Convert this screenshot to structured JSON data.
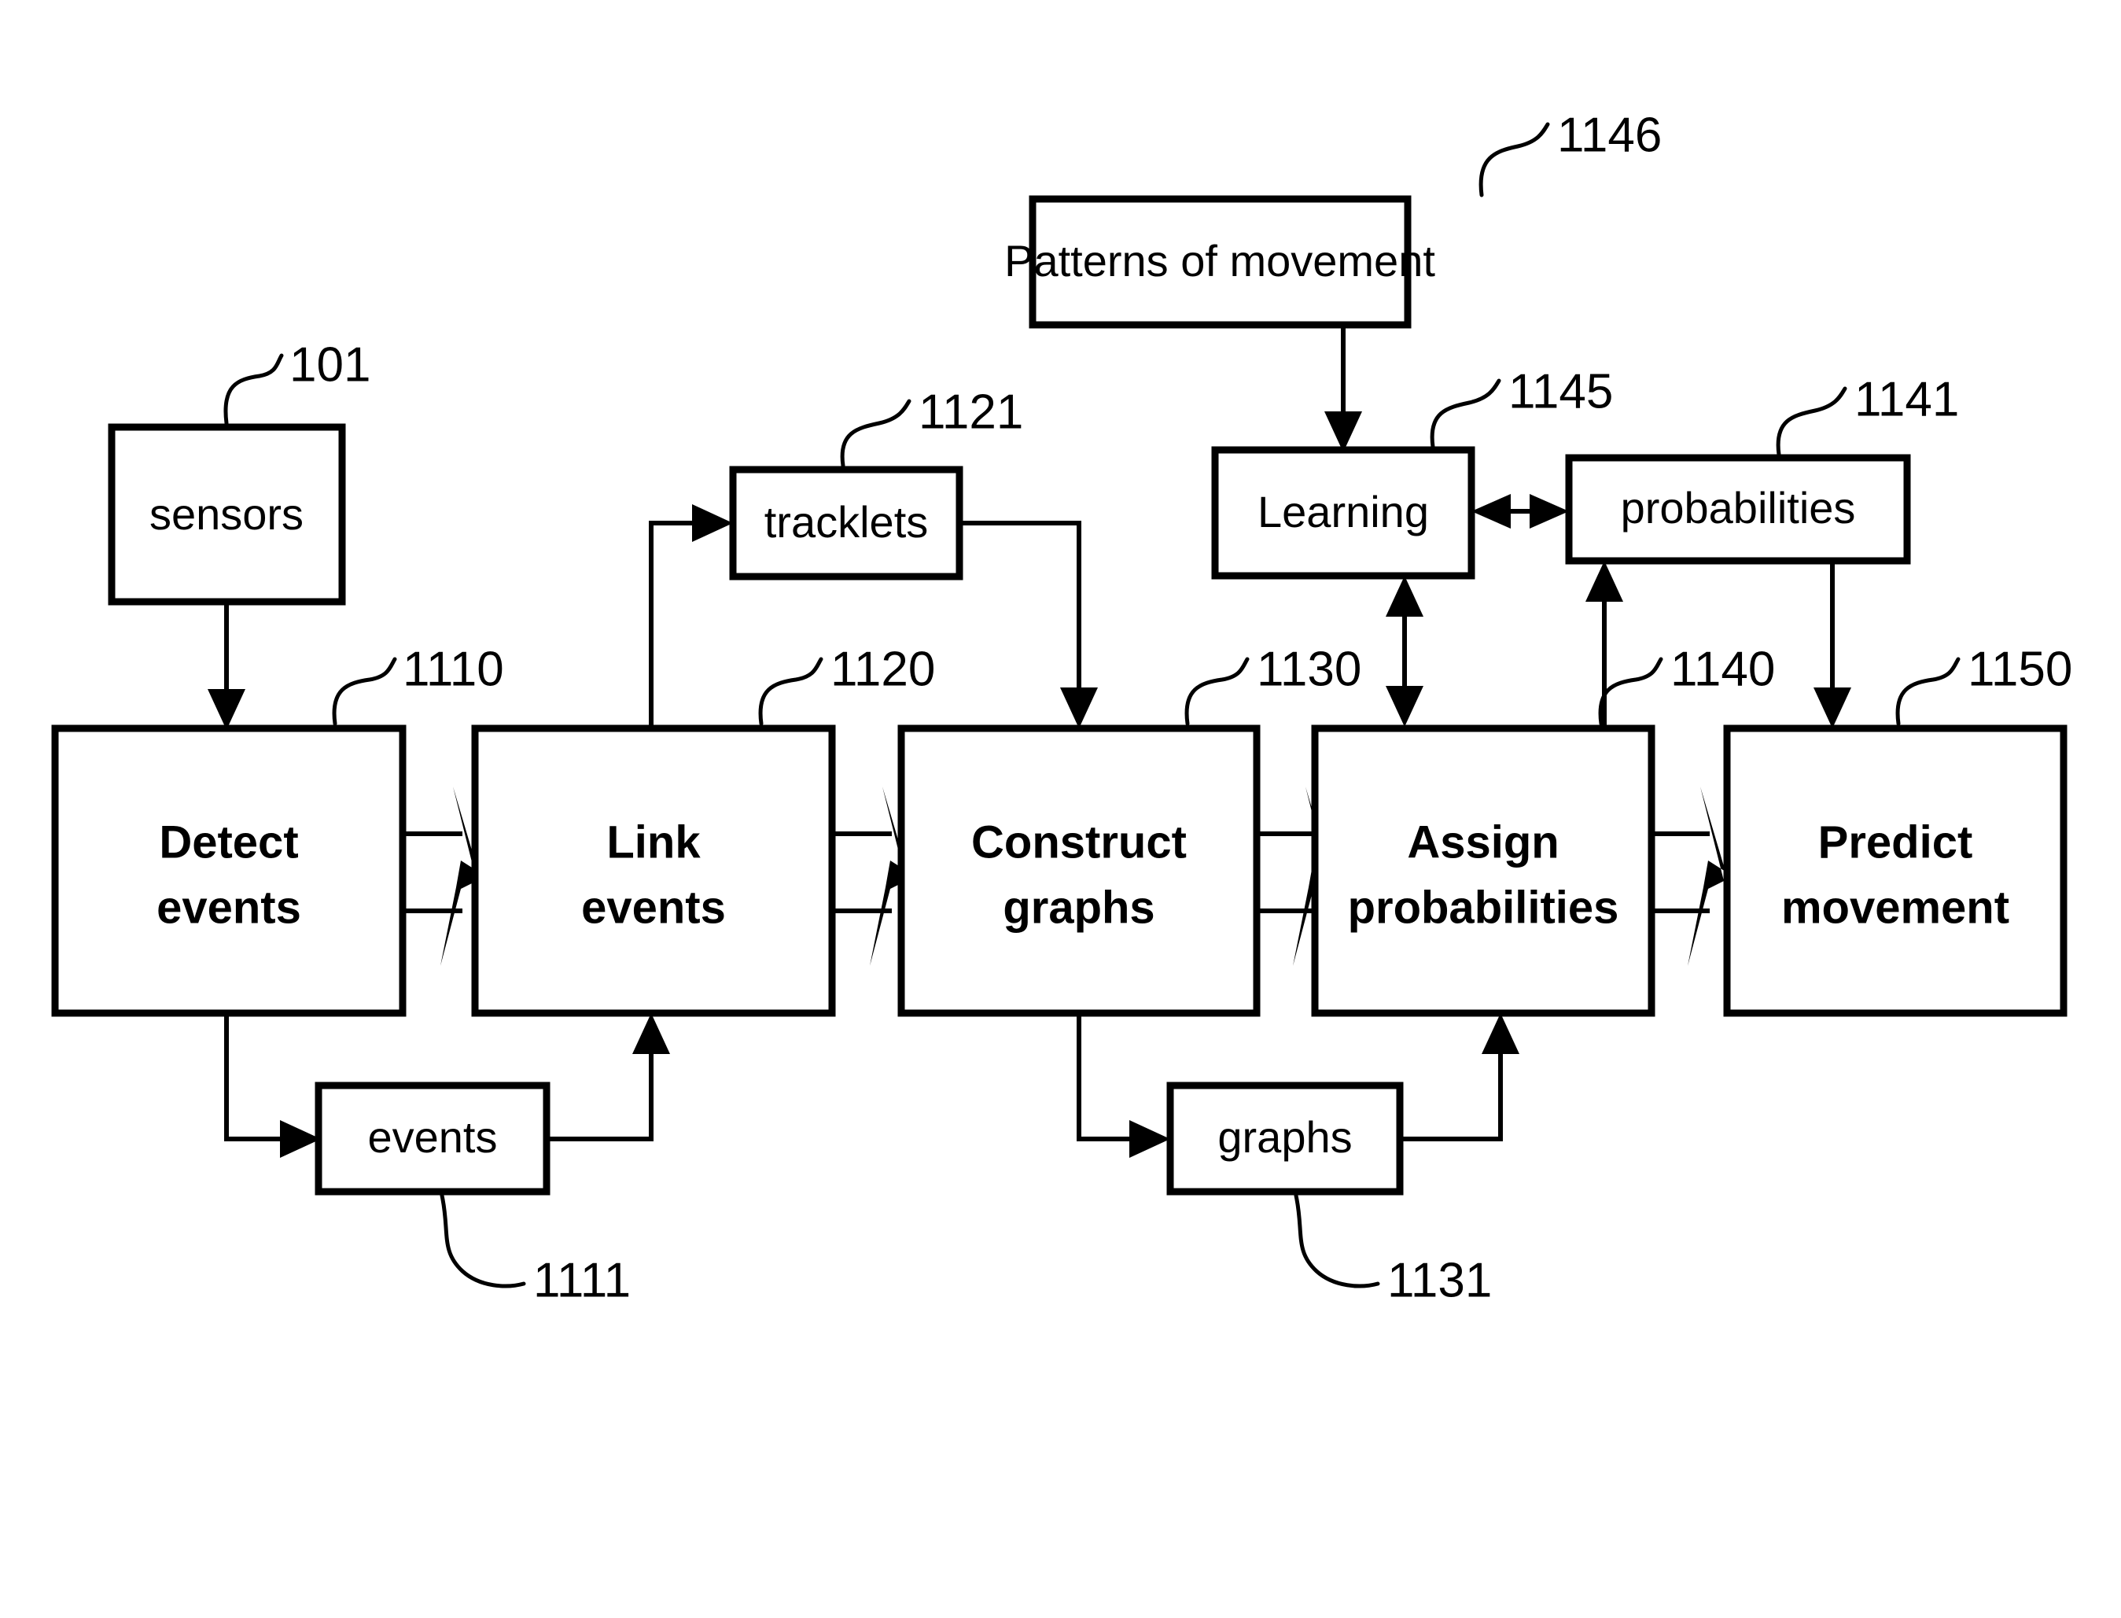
{
  "figure": {
    "type": "patent-flow-diagram",
    "background_color": "#ffffff",
    "line_color": "#000000"
  },
  "process_boxes": [
    {
      "id": "detect-events",
      "label_line1": "Detect",
      "label_line2": "events",
      "ref": "1110"
    },
    {
      "id": "link-events",
      "label_line1": "Link",
      "label_line2": "events",
      "ref": "1120"
    },
    {
      "id": "construct-graphs",
      "label_line1": "Construct",
      "label_line2": "graphs",
      "ref": "1130"
    },
    {
      "id": "assign-probabilities",
      "label_line1": "Assign",
      "label_line2": "probabilities",
      "ref": "1140"
    },
    {
      "id": "predict-movement",
      "label_line1": "Predict",
      "label_line2": "movement",
      "ref": "1150"
    }
  ],
  "data_boxes": [
    {
      "id": "sensors",
      "label": "sensors",
      "ref": "101"
    },
    {
      "id": "tracklets",
      "label": "tracklets",
      "ref": "1121"
    },
    {
      "id": "events",
      "label": "events",
      "ref": "1111"
    },
    {
      "id": "graphs",
      "label": "graphs",
      "ref": "1131"
    },
    {
      "id": "patterns-of-movement",
      "label": "Patterns of movement",
      "ref": "1146"
    },
    {
      "id": "learning",
      "label": "Learning",
      "ref": "1145"
    },
    {
      "id": "probabilities",
      "label": "probabilities",
      "ref": "1141"
    }
  ],
  "reference_numerals": [
    {
      "id": "ref-101",
      "value": "101"
    },
    {
      "id": "ref-1110",
      "value": "1110"
    },
    {
      "id": "ref-1111",
      "value": "1111"
    },
    {
      "id": "ref-1120",
      "value": "1120"
    },
    {
      "id": "ref-1121",
      "value": "1121"
    },
    {
      "id": "ref-1130",
      "value": "1130"
    },
    {
      "id": "ref-1131",
      "value": "1131"
    },
    {
      "id": "ref-1140",
      "value": "1140"
    },
    {
      "id": "ref-1141",
      "value": "1141"
    },
    {
      "id": "ref-1145",
      "value": "1145"
    },
    {
      "id": "ref-1146",
      "value": "1146"
    },
    {
      "id": "ref-1150",
      "value": "1150"
    }
  ],
  "labels": {
    "sensors": "sensors",
    "detect_line1": "Detect",
    "detect_line2": "events",
    "link_line1": "Link",
    "link_line2": "events",
    "construct_line1": "Construct",
    "construct_line2": "graphs",
    "assign_line1": "Assign",
    "assign_line2": "probabilities",
    "predict_line1": "Predict",
    "predict_line2": "movement",
    "tracklets": "tracklets",
    "events": "events",
    "graphs": "graphs",
    "patterns_of_movement": "Patterns of movement",
    "learning": "Learning",
    "probabilities": "probabilities",
    "ref_101": "101",
    "ref_1110": "1110",
    "ref_1111": "1111",
    "ref_1120": "1120",
    "ref_1121": "1121",
    "ref_1130": "1130",
    "ref_1131": "1131",
    "ref_1140": "1140",
    "ref_1141": "1141",
    "ref_1145": "1145",
    "ref_1146": "1146",
    "ref_1150": "1150"
  },
  "connections": [
    {
      "from": "sensors",
      "to": "detect-events",
      "kind": "arrow-down"
    },
    {
      "from": "detect-events",
      "to": "link-events",
      "kind": "block-arrow-right"
    },
    {
      "from": "link-events",
      "to": "construct-graphs",
      "kind": "block-arrow-right"
    },
    {
      "from": "construct-graphs",
      "to": "assign-probabilities",
      "kind": "block-arrow-right"
    },
    {
      "from": "assign-probabilities",
      "to": "predict-movement",
      "kind": "block-arrow-right"
    },
    {
      "from": "detect-events",
      "to": "events",
      "kind": "elbow-arrow"
    },
    {
      "from": "events",
      "to": "link-events",
      "kind": "elbow-arrow"
    },
    {
      "from": "link-events",
      "to": "tracklets",
      "kind": "elbow-arrow"
    },
    {
      "from": "tracklets",
      "to": "construct-graphs",
      "kind": "elbow-arrow"
    },
    {
      "from": "construct-graphs",
      "to": "graphs",
      "kind": "elbow-arrow"
    },
    {
      "from": "graphs",
      "to": "assign-probabilities",
      "kind": "elbow-arrow"
    },
    {
      "from": "patterns-of-movement",
      "to": "learning",
      "kind": "arrow-down"
    },
    {
      "from": "learning",
      "to": "probabilities",
      "kind": "arrow-bidirectional-horizontal"
    },
    {
      "from": "learning",
      "to": "assign-probabilities",
      "kind": "arrow-bidirectional-vertical"
    },
    {
      "from": "assign-probabilities",
      "to": "probabilities",
      "kind": "arrow-up"
    },
    {
      "from": "probabilities",
      "to": "predict-movement",
      "kind": "arrow-down"
    }
  ]
}
